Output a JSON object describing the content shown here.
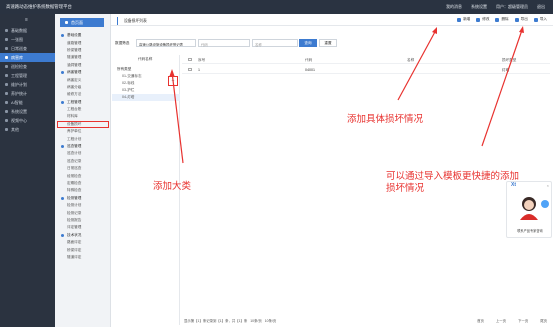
{
  "topbar": {
    "title": "高速路动态维护系统数据管理平台",
    "right_items": [
      "我的消息",
      "系统设置",
      "用户：超级管理员",
      "退出"
    ]
  },
  "sidebar": {
    "menu_icon": "hamburger-menu-icon",
    "items": [
      "基础数据",
      "一张图",
      "日常巡查",
      "病害库",
      "巡检检查",
      "工程管理",
      "维护计划",
      "养护统计",
      "AI智能",
      "系统设置",
      "视频中心",
      "其他"
    ],
    "active_index": 3
  },
  "subnav": {
    "home_label": "首页面",
    "items": [
      {
        "label": "基础设置",
        "group": true
      },
      {
        "label": "道路管理",
        "group": false
      },
      {
        "label": "桥梁管理",
        "group": false
      },
      {
        "label": "隧道管理",
        "group": false
      },
      {
        "label": "涵洞管理",
        "group": false
      },
      {
        "label": "病害管理",
        "group": true
      },
      {
        "label": "病害定义",
        "group": false
      },
      {
        "label": "病害分级",
        "group": false
      },
      {
        "label": "维修方法",
        "group": false
      },
      {
        "label": "工程管理",
        "group": true
      },
      {
        "label": "工程台账",
        "group": false
      },
      {
        "label": "材料库",
        "group": false
      },
      {
        "label": "设备损坏",
        "group": false
      },
      {
        "label": "养护单位",
        "group": false
      },
      {
        "label": "工程计划",
        "group": false
      },
      {
        "label": "巡查管理",
        "group": true
      },
      {
        "label": "巡查计划",
        "group": false
      },
      {
        "label": "巡查记录",
        "group": false
      },
      {
        "label": "日常巡查",
        "group": false
      },
      {
        "label": "经常检查",
        "group": false
      },
      {
        "label": "定期检查",
        "group": false
      },
      {
        "label": "特殊检查",
        "group": false
      },
      {
        "label": "检测管理",
        "group": true
      },
      {
        "label": "检测计划",
        "group": false
      },
      {
        "label": "检测记录",
        "group": false
      },
      {
        "label": "检测报告",
        "group": false
      },
      {
        "label": "评定管理",
        "group": false
      },
      {
        "label": "技术状况",
        "group": true
      },
      {
        "label": "路面评定",
        "group": false
      },
      {
        "label": "桥梁评定",
        "group": false
      },
      {
        "label": "隧道评定",
        "group": false
      }
    ],
    "highlight_index": 12
  },
  "tab": {
    "label": "设备损坏列表"
  },
  "toolbar": {
    "buttons": [
      {
        "label": "新增",
        "icon": "plus-circle-icon"
      },
      {
        "label": "修改",
        "icon": "edit-icon"
      },
      {
        "label": "删除",
        "icon": "trash-icon"
      },
      {
        "label": "导出",
        "icon": "download-icon"
      },
      {
        "label": "导入",
        "icon": "upload-icon"
      }
    ]
  },
  "filter": {
    "label": "数据筛选",
    "select_value": "高速公路设施设备损坏登记表",
    "input1_placeholder": "代码",
    "input2_placeholder": "名称",
    "query_label": "查询",
    "reset_label": "重置"
  },
  "tree": {
    "header": "代码名称",
    "items": [
      {
        "label": "所有类型",
        "root": true
      },
      {
        "label": "01-交通标志",
        "root": false
      },
      {
        "label": "02-标线",
        "root": false
      },
      {
        "label": "03-护栏",
        "root": false
      },
      {
        "label": "04-灯塔",
        "root": false
      }
    ],
    "selected_index": 4,
    "add_button_icon": "plus-icon"
  },
  "grid": {
    "columns": [
      "序号",
      "代码",
      "名称",
      "损坏类型"
    ],
    "rows": [
      {
        "seq": "1",
        "code": "04001",
        "name": "",
        "type": "灯塔"
      }
    ]
  },
  "pager": {
    "summary": "显示第【1】条记录到【1】条，共【1】条",
    "page_size": "10条/页",
    "page_size2": "10条/页",
    "links": [
      "首页",
      "上一页",
      "下一页",
      "尾页"
    ]
  },
  "annotations": {
    "add_category": "添加大类",
    "add_detail": "添加具体损坏情况",
    "import_template": "可以通过导入模板更快捷的添加\n损坏情况"
  },
  "chat": {
    "logo": "Xt",
    "text": "联系产品专家咨询",
    "close": "×"
  },
  "colors": {
    "accent": "#3d7bd0",
    "sidebar": "#2b3340",
    "annotation": "#e8322f"
  }
}
